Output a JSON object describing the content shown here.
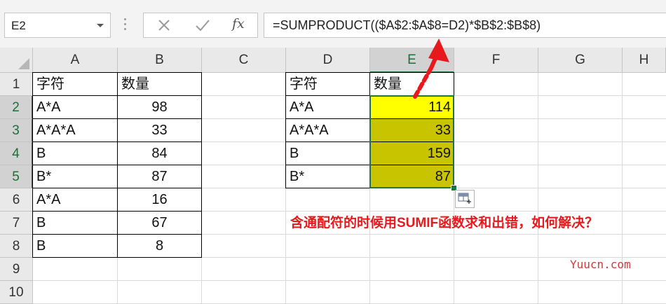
{
  "formula_bar": {
    "name_box": "E2",
    "fx_label": "fx",
    "formula": "=SUMPRODUCT(($A$2:$A$8=D2)*$B$2:$B$8)"
  },
  "columns": [
    "A",
    "B",
    "C",
    "D",
    "E",
    "F",
    "G",
    "H"
  ],
  "active_column": "E",
  "rows": [
    "1",
    "2",
    "3",
    "4",
    "5",
    "6",
    "7",
    "8",
    "9",
    "10"
  ],
  "active_rows": [
    "2",
    "3",
    "4",
    "5"
  ],
  "source_table": {
    "headers": [
      "字符",
      "数量"
    ],
    "rows": [
      [
        "A*A",
        "98"
      ],
      [
        "A*A*A",
        "33"
      ],
      [
        "B",
        "84"
      ],
      [
        "B*",
        "87"
      ],
      [
        "A*A",
        "16"
      ],
      [
        "B",
        "67"
      ],
      [
        "B",
        "8"
      ]
    ]
  },
  "result_table": {
    "headers": [
      "字符",
      "数量"
    ],
    "rows": [
      [
        "A*A",
        "114"
      ],
      [
        "A*A*A",
        "33"
      ],
      [
        "B",
        "159"
      ],
      [
        "B*",
        "87"
      ]
    ]
  },
  "colors": {
    "active_cell_fill": "#ffff00",
    "selection_fill": "#c8c400",
    "selection_border": "#217346",
    "annotation_red": "#e8191c"
  },
  "annotation": "含通配符的时候用SUMIF函数求和出错，如何解决？",
  "watermark": "Yuucn.com",
  "icons": {
    "cancel": "cancel-x-icon",
    "enter": "enter-check-icon",
    "fx": "insert-function-icon",
    "quick_analysis": "quick-analysis-icon",
    "arrow": "red-arrow-icon"
  }
}
